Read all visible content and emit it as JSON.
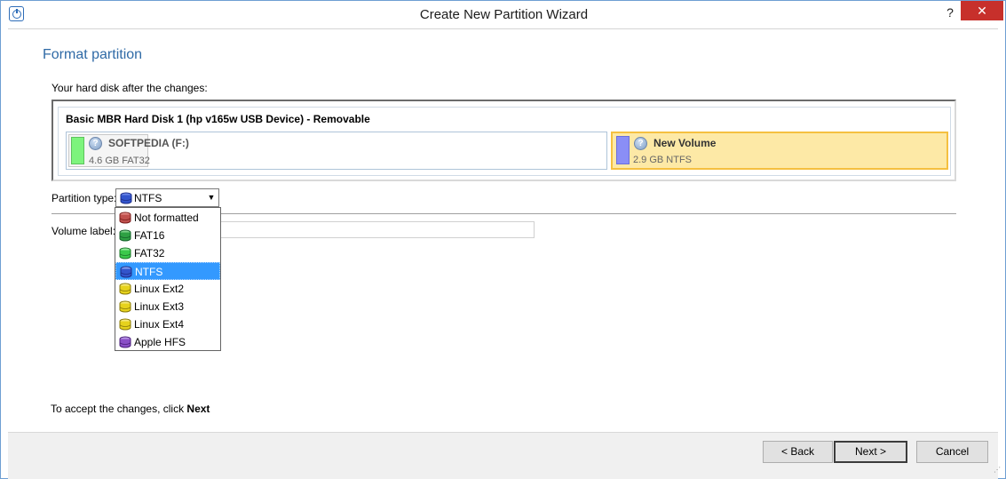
{
  "window": {
    "title": "Create New Partition Wizard",
    "help": "?",
    "close": "✕"
  },
  "page": {
    "title": "Format partition",
    "disk_caption": "Your hard disk after the changes:",
    "disk_name": "Basic MBR Hard Disk 1 (hp v165w USB Device) - Removable",
    "partitions": [
      {
        "name": "SOFTPEDIA (F:)",
        "size": "4.6 GB FAT32",
        "color": "#7df47d"
      },
      {
        "name": "New Volume",
        "size": "2.9 GB NTFS",
        "color": "#8a8ef6"
      }
    ],
    "partition_type_label": "Partition type:",
    "partition_type_value": "NTFS",
    "volume_label_label": "Volume label:",
    "volume_label_value": "",
    "dropdown_options": [
      {
        "label": "Not formatted",
        "color": "#c0504d"
      },
      {
        "label": "FAT16",
        "color": "#2ea043"
      },
      {
        "label": "FAT32",
        "color": "#3bc94b"
      },
      {
        "label": "NTFS",
        "color": "#3355cc"
      },
      {
        "label": "Linux Ext2",
        "color": "#e6d21c"
      },
      {
        "label": "Linux Ext3",
        "color": "#e6d21c"
      },
      {
        "label": "Linux Ext4",
        "color": "#e6d21c"
      },
      {
        "label": "Apple HFS",
        "color": "#8a4fc7"
      }
    ],
    "selected_option": "NTFS",
    "accept_prefix": "To accept the changes, click ",
    "accept_bold": "Next"
  },
  "footer": {
    "back": "< Back",
    "next": "Next >",
    "cancel": "Cancel"
  }
}
